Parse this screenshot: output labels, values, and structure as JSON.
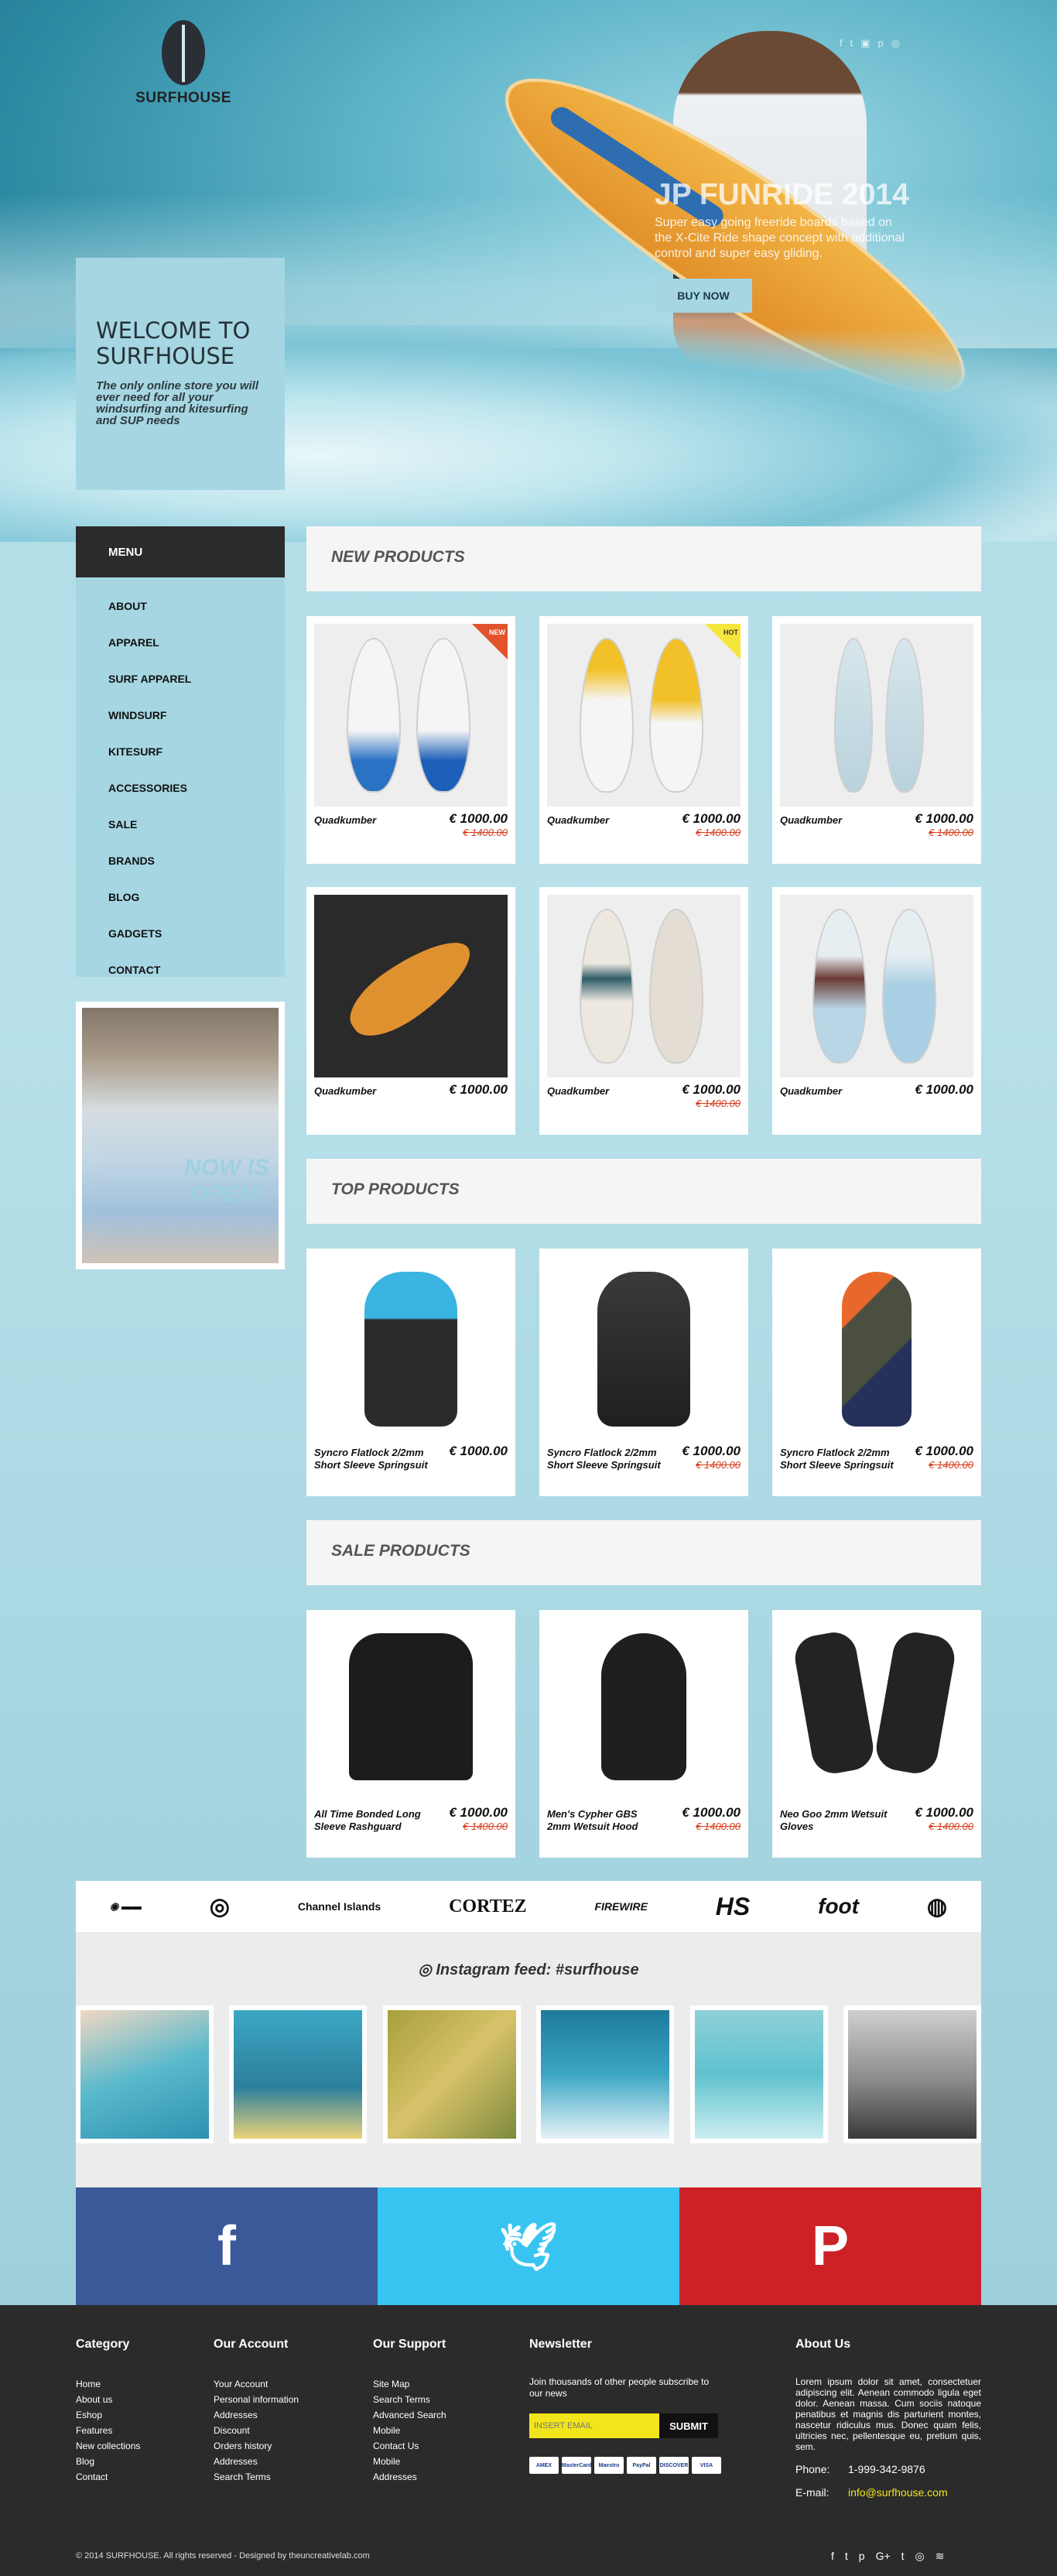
{
  "site": {
    "name": "SURFHOUSE"
  },
  "hero": {
    "welcome_title": "WELCOME TO SURFHOUSE",
    "welcome_text": "The only online store you will ever need for all your windsurfing and kitesurfing and SUP needs",
    "promo_title": "JP FUNRIDE 2014",
    "promo_text": "Super easy going freeride boards based on the X-Cite Ride shape concept with additional control and super easy gliding.",
    "promo_button": "BUY NOW",
    "social_icons": [
      "facebook-icon",
      "twitter-icon",
      "youtube-icon",
      "pinterest-icon",
      "instagram-icon"
    ]
  },
  "sidebar": {
    "menu_title": "MENU",
    "items": [
      {
        "label": "ABOUT"
      },
      {
        "label": "APPAREL"
      },
      {
        "label": "SURF APPAREL"
      },
      {
        "label": "WINDSURF"
      },
      {
        "label": "KITESURF"
      },
      {
        "label": "ACCESSORIES"
      },
      {
        "label": "SALE"
      },
      {
        "label": "BRANDS"
      },
      {
        "label": "BLOG"
      },
      {
        "label": "GADGETS"
      },
      {
        "label": "CONTACT"
      }
    ],
    "store_banner": "NOW IS OPEN!"
  },
  "new_products": {
    "title": "NEW PRODUCTS",
    "items": [
      {
        "name": "Quadkumber",
        "price": "€ 1000.00",
        "old_price": "€ 1400.00",
        "badge": "NEW"
      },
      {
        "name": "Quadkumber",
        "price": "€ 1000.00",
        "old_price": "€ 1400.00",
        "badge": "HOT"
      },
      {
        "name": "Quadkumber",
        "price": "€ 1000.00",
        "old_price": "€ 1400.00"
      },
      {
        "name": "Quadkumber",
        "price": "€ 1000.00"
      },
      {
        "name": "Quadkumber",
        "price": "€ 1000.00",
        "old_price": "€ 1400.00"
      },
      {
        "name": "Quadkumber",
        "price": "€ 1000.00"
      }
    ]
  },
  "top_products": {
    "title": "TOP PRODUCTS",
    "items": [
      {
        "name": "Syncro Flatlock 2/2mm Short Sleeve Springsuit",
        "price": "€ 1000.00"
      },
      {
        "name": "Syncro Flatlock 2/2mm Short Sleeve Springsuit",
        "price": "€ 1000.00",
        "old_price": "€ 1400.00"
      },
      {
        "name": "Syncro Flatlock 2/2mm Short Sleeve Springsuit",
        "price": "€ 1000.00",
        "old_price": "€ 1400.00"
      }
    ]
  },
  "sale_products": {
    "title": "SALE PRODUCTS",
    "items": [
      {
        "name": "All Time Bonded Long Sleeve Rashguard",
        "price": "€ 1000.00",
        "old_price": "€ 1400.00"
      },
      {
        "name": "Men's Cypher GBS 2mm Wetsuit Hood",
        "price": "€ 1000.00",
        "old_price": "€ 1400.00"
      },
      {
        "name": "Neo Goo 2mm Wetsuit Gloves",
        "price": "€ 1000.00",
        "old_price": "€ 1400.00"
      }
    ]
  },
  "brands": [
    "Channel Islands",
    "CORTEZ",
    "FIREWIRE"
  ],
  "instagram": {
    "title": "Instagram feed: #surfhouse"
  },
  "footer": {
    "category": {
      "title": "Category",
      "links": [
        "Home",
        "About us",
        "Eshop",
        "Features",
        "New collections",
        "Blog",
        "Contact"
      ]
    },
    "account": {
      "title": "Our Account",
      "links": [
        "Your Account",
        "Personal information",
        "Addresses",
        "Discount",
        "Orders history",
        "Addresses",
        "Search Terms"
      ]
    },
    "support": {
      "title": "Our Support",
      "links": [
        "Site Map",
        "Search Terms",
        "Advanced Search",
        "Mobile",
        "Contact Us",
        "Mobile",
        "Addresses"
      ]
    },
    "newsletter": {
      "title": "Newsletter",
      "text": "Join thousands of other people subscribe to our news",
      "placeholder": "INSERT EMAIL",
      "button": "SUBMIT",
      "cards": [
        "VISA",
        "PayPal",
        "DISCOVER",
        "Maestro",
        "MasterCard",
        "AMEX"
      ]
    },
    "about": {
      "title": "About Us",
      "text": "Lorem ipsum dolor sit amet, consectetuer adipiscing elit. Aenean commodo ligula eget dolor. Aenean massa. Cum sociis natoque penatibus et magnis dis parturient montes, nascetur ridiculus mus. Donec quam felis, ultricies nec, pellentesque eu, pretium quis, sem.",
      "phone_label": "Phone:",
      "phone": "1-999-342-9876",
      "email_label": "E-mail:",
      "email": "info@surfhouse.com"
    },
    "copyright": "© 2014 SURFHOUSE. All rights reserved - Designed by theuncreativelab.com",
    "social": [
      "f",
      "t",
      "p",
      "G+",
      "t",
      "◎",
      "≋"
    ]
  }
}
